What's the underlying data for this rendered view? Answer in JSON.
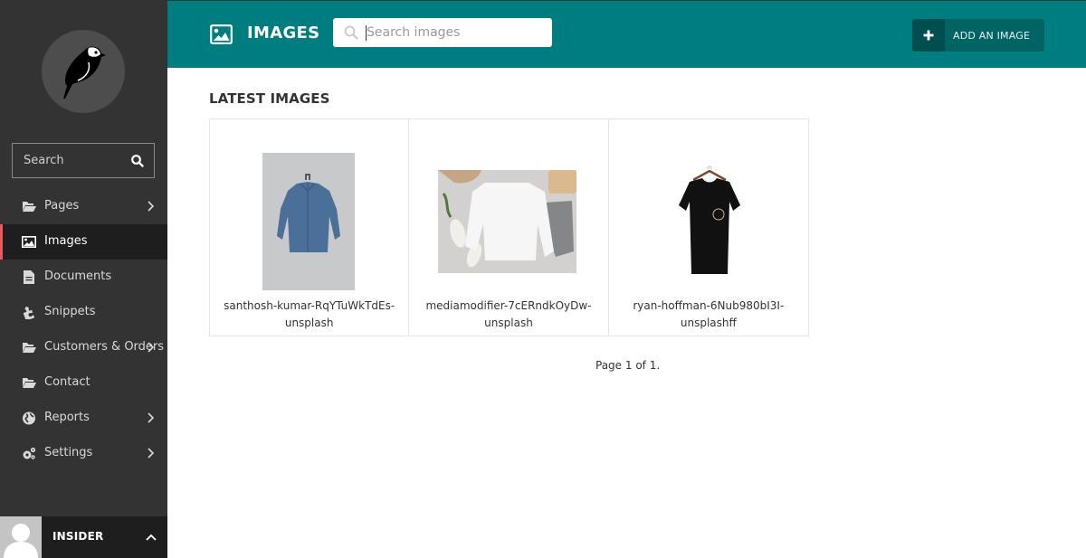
{
  "sidebar": {
    "logo_alt": "bird-logo",
    "search_placeholder": "Search",
    "items": [
      {
        "label": "Pages",
        "icon": "folder-open-icon",
        "has_children": true,
        "active": false
      },
      {
        "label": "Images",
        "icon": "image-icon",
        "has_children": false,
        "active": true
      },
      {
        "label": "Documents",
        "icon": "document-icon",
        "has_children": false,
        "active": false
      },
      {
        "label": "Snippets",
        "icon": "puzzle-icon",
        "has_children": false,
        "active": false
      },
      {
        "label": "Customers & Orders",
        "icon": "folder-open-icon",
        "has_children": true,
        "active": false
      },
      {
        "label": "Contact",
        "icon": "folder-open-icon",
        "has_children": false,
        "active": false
      },
      {
        "label": "Reports",
        "icon": "globe-icon",
        "has_children": true,
        "active": false
      },
      {
        "label": "Settings",
        "icon": "cogs-icon",
        "has_children": true,
        "active": false
      }
    ],
    "user": {
      "name": "INSIDER"
    }
  },
  "header": {
    "title": "IMAGES",
    "search_placeholder": "Search images",
    "add_button_label": "ADD AN IMAGE"
  },
  "main": {
    "section_title": "LATEST IMAGES",
    "images": [
      {
        "caption_line1": "santhosh-kumar-RqYTuWkTdEs-",
        "caption_line2": "unsplash"
      },
      {
        "caption_line1": "mediamodifier-7cERndkOyDw-",
        "caption_line2": "unsplash"
      },
      {
        "caption_line1": "ryan-hoffman-6Nub980bI3I-",
        "caption_line2": "unsplashff"
      }
    ],
    "pagination": "Page 1 of 1."
  },
  "colors": {
    "header_bg": "#007d7e",
    "sidebar_bg": "#333333",
    "active_item_bg": "#1e1e1e",
    "active_indicator": "#e9585f",
    "add_button_bg": "#006465"
  }
}
